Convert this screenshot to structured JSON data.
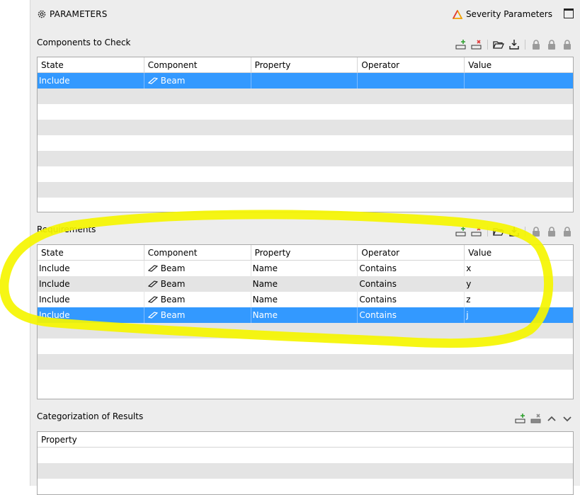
{
  "header": {
    "title": "PARAMETERS",
    "severity_label": "Severity Parameters"
  },
  "components_section": {
    "title": "Components to Check",
    "columns": [
      "State",
      "Component",
      "Property",
      "Operator",
      "Value"
    ],
    "rows": [
      {
        "state": "Include",
        "component": "Beam",
        "property": "",
        "operator": "",
        "value": "",
        "selected": true
      }
    ],
    "empty_rows": 8
  },
  "requirements_section": {
    "title": "Requirements",
    "columns": [
      "State",
      "Component",
      "Property",
      "Operator",
      "Value"
    ],
    "rows": [
      {
        "state": "Include",
        "component": "Beam",
        "property": "Name",
        "operator": "Contains",
        "value": "x"
      },
      {
        "state": "Include",
        "component": "Beam",
        "property": "Name",
        "operator": "Contains",
        "value": "y"
      },
      {
        "state": "Include",
        "component": "Beam",
        "property": "Name",
        "operator": "Contains",
        "value": "z"
      },
      {
        "state": "Include",
        "component": "Beam",
        "property": "Name",
        "operator": "Contains",
        "value": "j",
        "selected": true
      }
    ],
    "empty_rows": 4
  },
  "categorization_section": {
    "title": "Categorization of Results",
    "columns": [
      "Property"
    ]
  },
  "icons": {
    "settings": "gear-icon",
    "severity": "warning-triangle-icon",
    "maximize": "maximize-icon",
    "add_row": "add-row-icon",
    "delete_row": "delete-row-icon",
    "open": "folder-open-icon",
    "save": "download-icon",
    "lock": "lock-icon",
    "move_up": "chevron-up-icon",
    "move_down": "chevron-down-icon",
    "beam": "beam-icon"
  },
  "colors": {
    "selection": "#3399ff",
    "alt_row": "#e4e4e4",
    "panel": "#ededed",
    "annotation": "#f5f500",
    "add_green": "#2fa02f",
    "delete_red": "#e03a3a"
  }
}
